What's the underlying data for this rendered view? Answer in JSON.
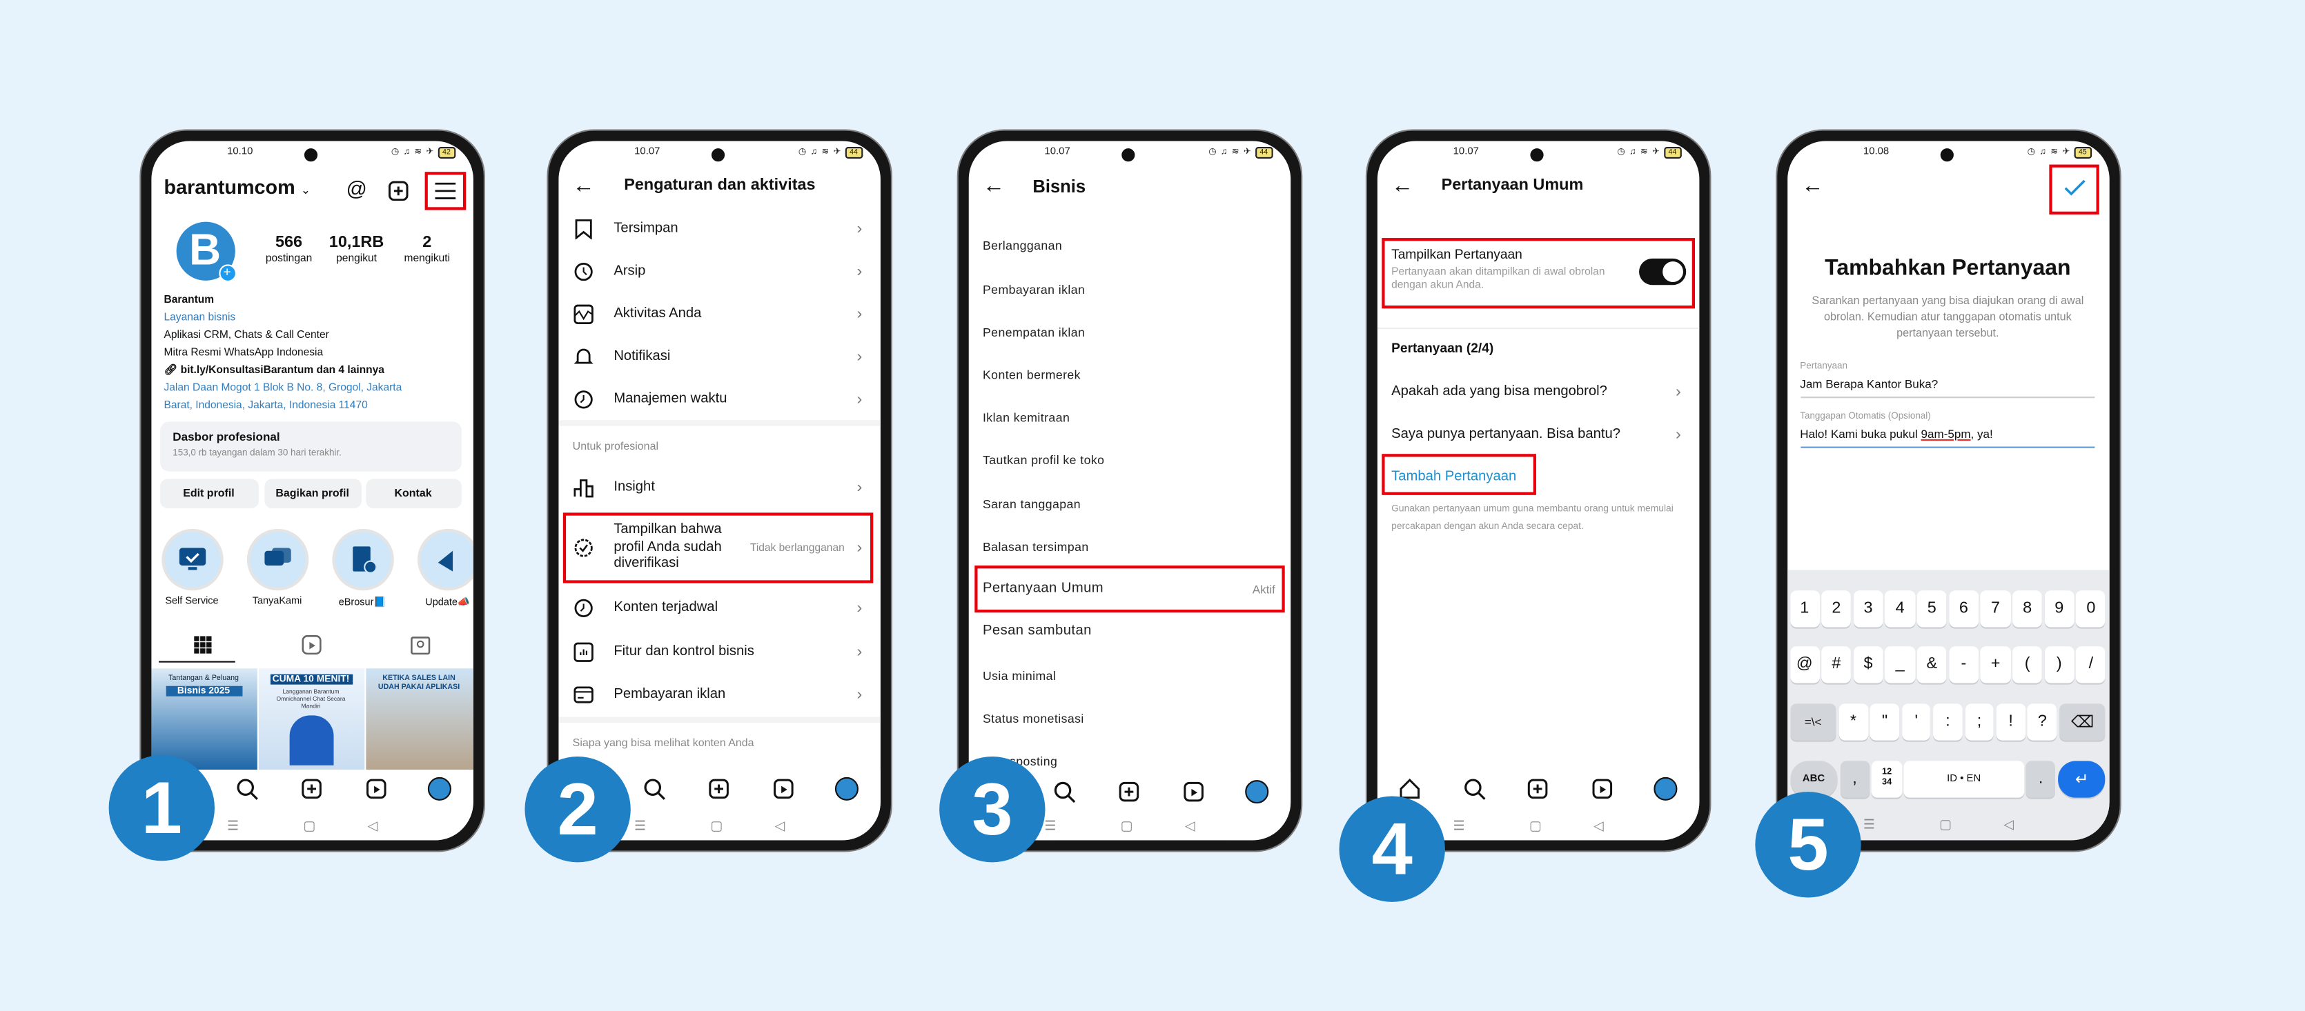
{
  "colors": {
    "background": "#e6f2fc",
    "badge": "#1f80c6",
    "highlight": "#e8000b",
    "link": "#1b8fd1"
  },
  "steps": [
    {
      "badge": "1",
      "status": {
        "time": "10.10",
        "battery": "42"
      },
      "username": "barantumcom",
      "icons": [
        "threads-icon",
        "new-post-icon",
        "menu-icon"
      ],
      "stats": [
        {
          "value": "566",
          "label": "postingan"
        },
        {
          "value": "10,1RB",
          "label": "pengikut"
        },
        {
          "value": "2",
          "label": "mengikuti"
        }
      ],
      "bio": {
        "name": "Barantum",
        "category": "Layanan bisnis",
        "line1": "Aplikasi CRM, Chats & Call Center",
        "line2": "Mitra Resmi WhatsApp Indonesia",
        "link": "bit.ly/KonsultasiBarantum dan 4 lainnya",
        "address1": "Jalan Daan Mogot 1 Blok B No. 8, Grogol, Jakarta",
        "address2": "Barat, Indonesia, Jakarta, Indonesia 11470"
      },
      "dashboard": {
        "title": "Dasbor profesional",
        "subtitle": "153,0 rb tayangan dalam 30 hari terakhir."
      },
      "buttons": [
        "Edit profil",
        "Bagikan profil",
        "Kontak"
      ],
      "highlights": [
        "Self Service",
        "TanyaKami",
        "eBrosur📘",
        "Update📣"
      ],
      "posts": [
        {
          "line1": "Tantangan & Peluang",
          "line2": "Bisnis 2025"
        },
        {
          "line1": "CUMA 10 MENIT!",
          "line2": "Langganan Barantum Omnichannel Chat Secara Mandiri"
        },
        {
          "line1": "KETIKA SALES LAIN",
          "line2": "UDAH PAKAI APLIKASI"
        }
      ]
    },
    {
      "badge": "2",
      "status": {
        "time": "10.07",
        "battery": "44"
      },
      "title": "Pengaturan dan aktivitas",
      "items": [
        {
          "label": "Tersimpan",
          "icon": "bookmark-icon"
        },
        {
          "label": "Arsip",
          "icon": "archive-icon"
        },
        {
          "label": "Aktivitas Anda",
          "icon": "activity-icon"
        },
        {
          "label": "Notifikasi",
          "icon": "bell-icon"
        },
        {
          "label": "Manajemen waktu",
          "icon": "clock-icon"
        }
      ],
      "section1": "Untuk profesional",
      "insight": "Insight",
      "verified": {
        "label": "Tampilkan bahwa profil Anda sudah diverifikasi",
        "value": "Tidak berlangganan"
      },
      "items2": [
        {
          "label": "Konten terjadwal"
        },
        {
          "label": "Fitur dan kontrol bisnis"
        },
        {
          "label": "Pembayaran iklan"
        }
      ],
      "section2": "Siapa yang bisa melihat konten Anda"
    },
    {
      "badge": "3",
      "status": {
        "time": "10.07",
        "battery": "44"
      },
      "title": "Bisnis",
      "items": [
        "Berlangganan",
        "Pembayaran iklan",
        "Penempatan iklan",
        "Konten bermerek",
        "Iklan kemitraan",
        "Tautkan profil ke toko",
        "Saran tanggapan",
        "Balasan tersimpan",
        "Pertanyaan Umum",
        "Pesan sambutan",
        "Usia minimal",
        "Status monetisasi",
        "Crossposting"
      ],
      "active_value": "Aktif"
    },
    {
      "badge": "4",
      "status": {
        "time": "10.07",
        "battery": "44"
      },
      "title": "Pertanyaan Umum",
      "toggle": {
        "label": "Tampilkan Pertanyaan",
        "description": "Pertanyaan akan ditampilkan di awal obrolan dengan akun Anda.",
        "on": true
      },
      "section": "Pertanyaan (2/4)",
      "questions": [
        "Apakah ada yang bisa mengobrol?",
        "Saya punya pertanyaan. Bisa bantu?"
      ],
      "add": "Tambah Pertanyaan",
      "note": "Gunakan pertanyaan umum guna membantu orang untuk memulai percakapan dengan akun Anda secara cepat."
    },
    {
      "badge": "5",
      "status": {
        "time": "10.08",
        "battery": "45"
      },
      "title": "Tambahkan Pertanyaan",
      "description": "Sarankan pertanyaan yang bisa diajukan orang di awal obrolan. Kemudian atur tanggapan otomatis untuk pertanyaan tersebut.",
      "question_label": "Pertanyaan",
      "question_value": "Jam Berapa Kantor Buka?",
      "reply_label": "Tanggapan Otomatis (Opsional)",
      "reply_before": "Halo! Kami buka pukul ",
      "reply_marked": "9am-5pm",
      "reply_after": ", ya!",
      "keyboard": {
        "row1": [
          "1",
          "2",
          "3",
          "4",
          "5",
          "6",
          "7",
          "8",
          "9",
          "0"
        ],
        "row2": [
          "@",
          "#",
          "$",
          "_",
          "&",
          "-",
          "+",
          "(",
          ")",
          "/"
        ],
        "row3": [
          "=\\<",
          "*",
          "\"",
          "'",
          ":",
          ";",
          "!",
          "?"
        ],
        "abc": "ABC",
        "comma": ",",
        "num": "12 34",
        "space": "ID • EN",
        "period": "."
      }
    }
  ]
}
